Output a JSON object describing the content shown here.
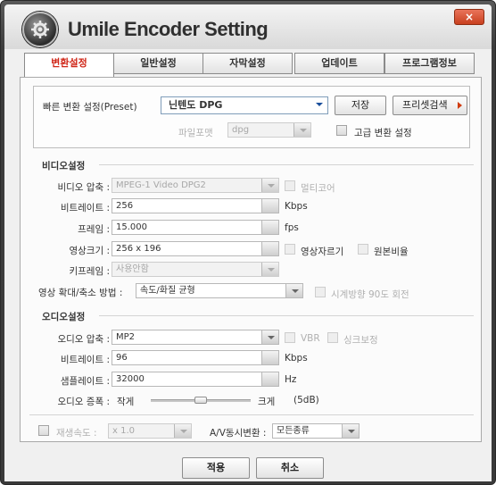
{
  "window": {
    "title": "Umile Encoder Setting",
    "close_label": "×"
  },
  "tabs": [
    {
      "label": "변환설정",
      "active": true
    },
    {
      "label": "일반설정",
      "active": false
    },
    {
      "label": "자막설정",
      "active": false
    },
    {
      "label": "업데이트",
      "active": false
    },
    {
      "label": "프로그램정보",
      "active": false
    }
  ],
  "preset": {
    "label": "빠른 변환 설정(Preset)",
    "value": "닌텐도 DPG",
    "save_label": "저장",
    "search_label": "프리셋검색",
    "format_label": "파일포맷",
    "format_value": "dpg",
    "advanced_label": "고급 변환 설정"
  },
  "video": {
    "section_title": "비디오설정",
    "codec_label": "비디오 압축 :",
    "codec_value": "MPEG-1 Video DPG2",
    "multicore_label": "멀티코어",
    "bitrate_label": "비트레이트 :",
    "bitrate_value": "256",
    "bitrate_unit": "Kbps",
    "frame_label": "프레임 :",
    "frame_value": "15.000",
    "frame_unit": "fps",
    "size_label": "영상크기 :",
    "size_value": "256 x 196",
    "crop_label": "영상자르기",
    "original_ratio_label": "원본비율",
    "keyframe_label": "키프레임 :",
    "keyframe_value": "사용안함",
    "scale_label": "영상 확대/축소 방법 :",
    "scale_value": "속도/화질 균형",
    "rotate_label": "시계방향 90도 회전"
  },
  "audio": {
    "section_title": "오디오설정",
    "codec_label": "오디오 압축 :",
    "codec_value": "MP2",
    "vbr_label": "VBR",
    "sync_label": "싱크보정",
    "bitrate_label": "비트레이트 :",
    "bitrate_value": "96",
    "bitrate_unit": "Kbps",
    "samplerate_label": "샘플레이트 :",
    "samplerate_value": "32000",
    "samplerate_unit": "Hz",
    "amplify_label": "오디오 증폭 :",
    "amplify_min": "작게",
    "amplify_max": "크게",
    "amplify_db": "(5dB)",
    "amplify_level": 0.5
  },
  "playback": {
    "speed_label": "재생속도 :",
    "speed_value": "x 1.0",
    "av_label": "A/V동시변환 :",
    "av_value": "모든종류"
  },
  "footer": {
    "apply_label": "적용",
    "cancel_label": "취소"
  }
}
